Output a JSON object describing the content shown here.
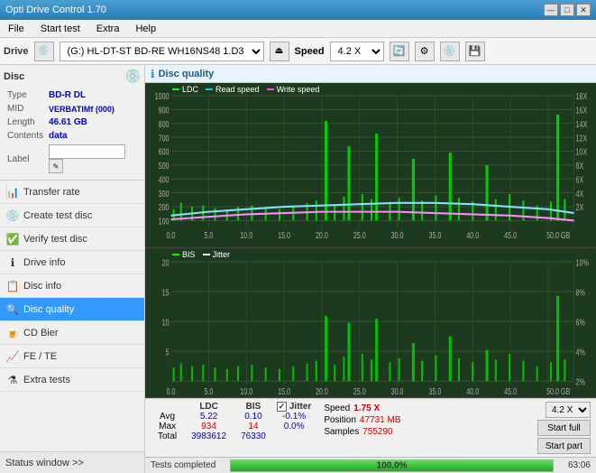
{
  "app": {
    "title": "Opti Drive Control 1.70",
    "titlebar_controls": [
      "—",
      "□",
      "✕"
    ]
  },
  "menubar": {
    "items": [
      "File",
      "Start test",
      "Extra",
      "Help"
    ]
  },
  "toolbar": {
    "drive_label": "Drive",
    "drive_value": "(G:)  HL-DT-ST BD-RE  WH16NS48 1.D3",
    "speed_label": "Speed",
    "speed_value": "4.2 X"
  },
  "disc": {
    "title": "Disc",
    "type_label": "Type",
    "type_value": "BD-R DL",
    "mid_label": "MID",
    "mid_value": "VERBATIMf (000)",
    "length_label": "Length",
    "length_value": "46.61 GB",
    "contents_label": "Contents",
    "contents_value": "data",
    "label_label": "Label",
    "label_placeholder": ""
  },
  "sidebar_nav": [
    {
      "id": "transfer-rate",
      "label": "Transfer rate",
      "active": false
    },
    {
      "id": "create-test-disc",
      "label": "Create test disc",
      "active": false
    },
    {
      "id": "verify-test-disc",
      "label": "Verify test disc",
      "active": false
    },
    {
      "id": "drive-info",
      "label": "Drive info",
      "active": false
    },
    {
      "id": "disc-info",
      "label": "Disc info",
      "active": false
    },
    {
      "id": "disc-quality",
      "label": "Disc quality",
      "active": true
    },
    {
      "id": "cd-bier",
      "label": "CD Bier",
      "active": false
    },
    {
      "id": "fe-te",
      "label": "FE / TE",
      "active": false
    },
    {
      "id": "extra-tests",
      "label": "Extra tests",
      "active": false
    }
  ],
  "status_window_btn": "Status window >>",
  "disc_quality": {
    "title": "Disc quality",
    "legend": {
      "ldc": "LDC",
      "read_speed": "Read speed",
      "write_speed": "Write speed"
    },
    "chart1": {
      "y_labels": [
        "1000",
        "900",
        "800",
        "700",
        "600",
        "500",
        "400",
        "300",
        "200",
        "100"
      ],
      "y_labels_right": [
        "18X",
        "16X",
        "14X",
        "12X",
        "10X",
        "8X",
        "6X",
        "4X",
        "2X"
      ],
      "x_labels": [
        "0.0",
        "5.0",
        "10.0",
        "15.0",
        "20.0",
        "25.0",
        "30.0",
        "35.0",
        "40.0",
        "45.0",
        "50.0 GB"
      ]
    },
    "chart2": {
      "legend_bis": "BIS",
      "legend_jitter": "Jitter",
      "y_labels": [
        "20",
        "15",
        "10",
        "5"
      ],
      "y_labels_right": [
        "10%",
        "8%",
        "6%",
        "4%",
        "2%"
      ],
      "x_labels": [
        "0.0",
        "5.0",
        "10.0",
        "15.0",
        "20.0",
        "25.0",
        "30.0",
        "35.0",
        "40.0",
        "45.0",
        "50.0 GB"
      ]
    },
    "stats": {
      "headers": [
        "LDC",
        "BIS",
        "",
        "Jitter",
        "Speed",
        "",
        ""
      ],
      "avg_label": "Avg",
      "avg_ldc": "5.22",
      "avg_bis": "0.10",
      "avg_jitter": "-0.1%",
      "max_label": "Max",
      "max_ldc": "934",
      "max_bis": "14",
      "max_jitter": "0.0%",
      "total_label": "Total",
      "total_ldc": "3983612",
      "total_bis": "76330",
      "speed_label": "Speed",
      "speed_value": "1.75 X",
      "position_label": "Position",
      "position_value": "47731 MB",
      "samples_label": "Samples",
      "samples_value": "755290",
      "speed_dropdown": "4.2 X",
      "jitter_checked": true
    },
    "buttons": {
      "start_full": "Start full",
      "start_part": "Start part"
    }
  },
  "statusbar": {
    "text": "Tests completed",
    "progress": "100.0%",
    "time": "63:06"
  },
  "colors": {
    "ldc_bar": "#00ff00",
    "read_speed": "#00ccff",
    "write_speed": "#ff44ff",
    "bis_bar": "#00ff00",
    "chart_bg": "#1e3a1e",
    "grid": "#3a5a3a",
    "active_nav": "#3399ff"
  }
}
